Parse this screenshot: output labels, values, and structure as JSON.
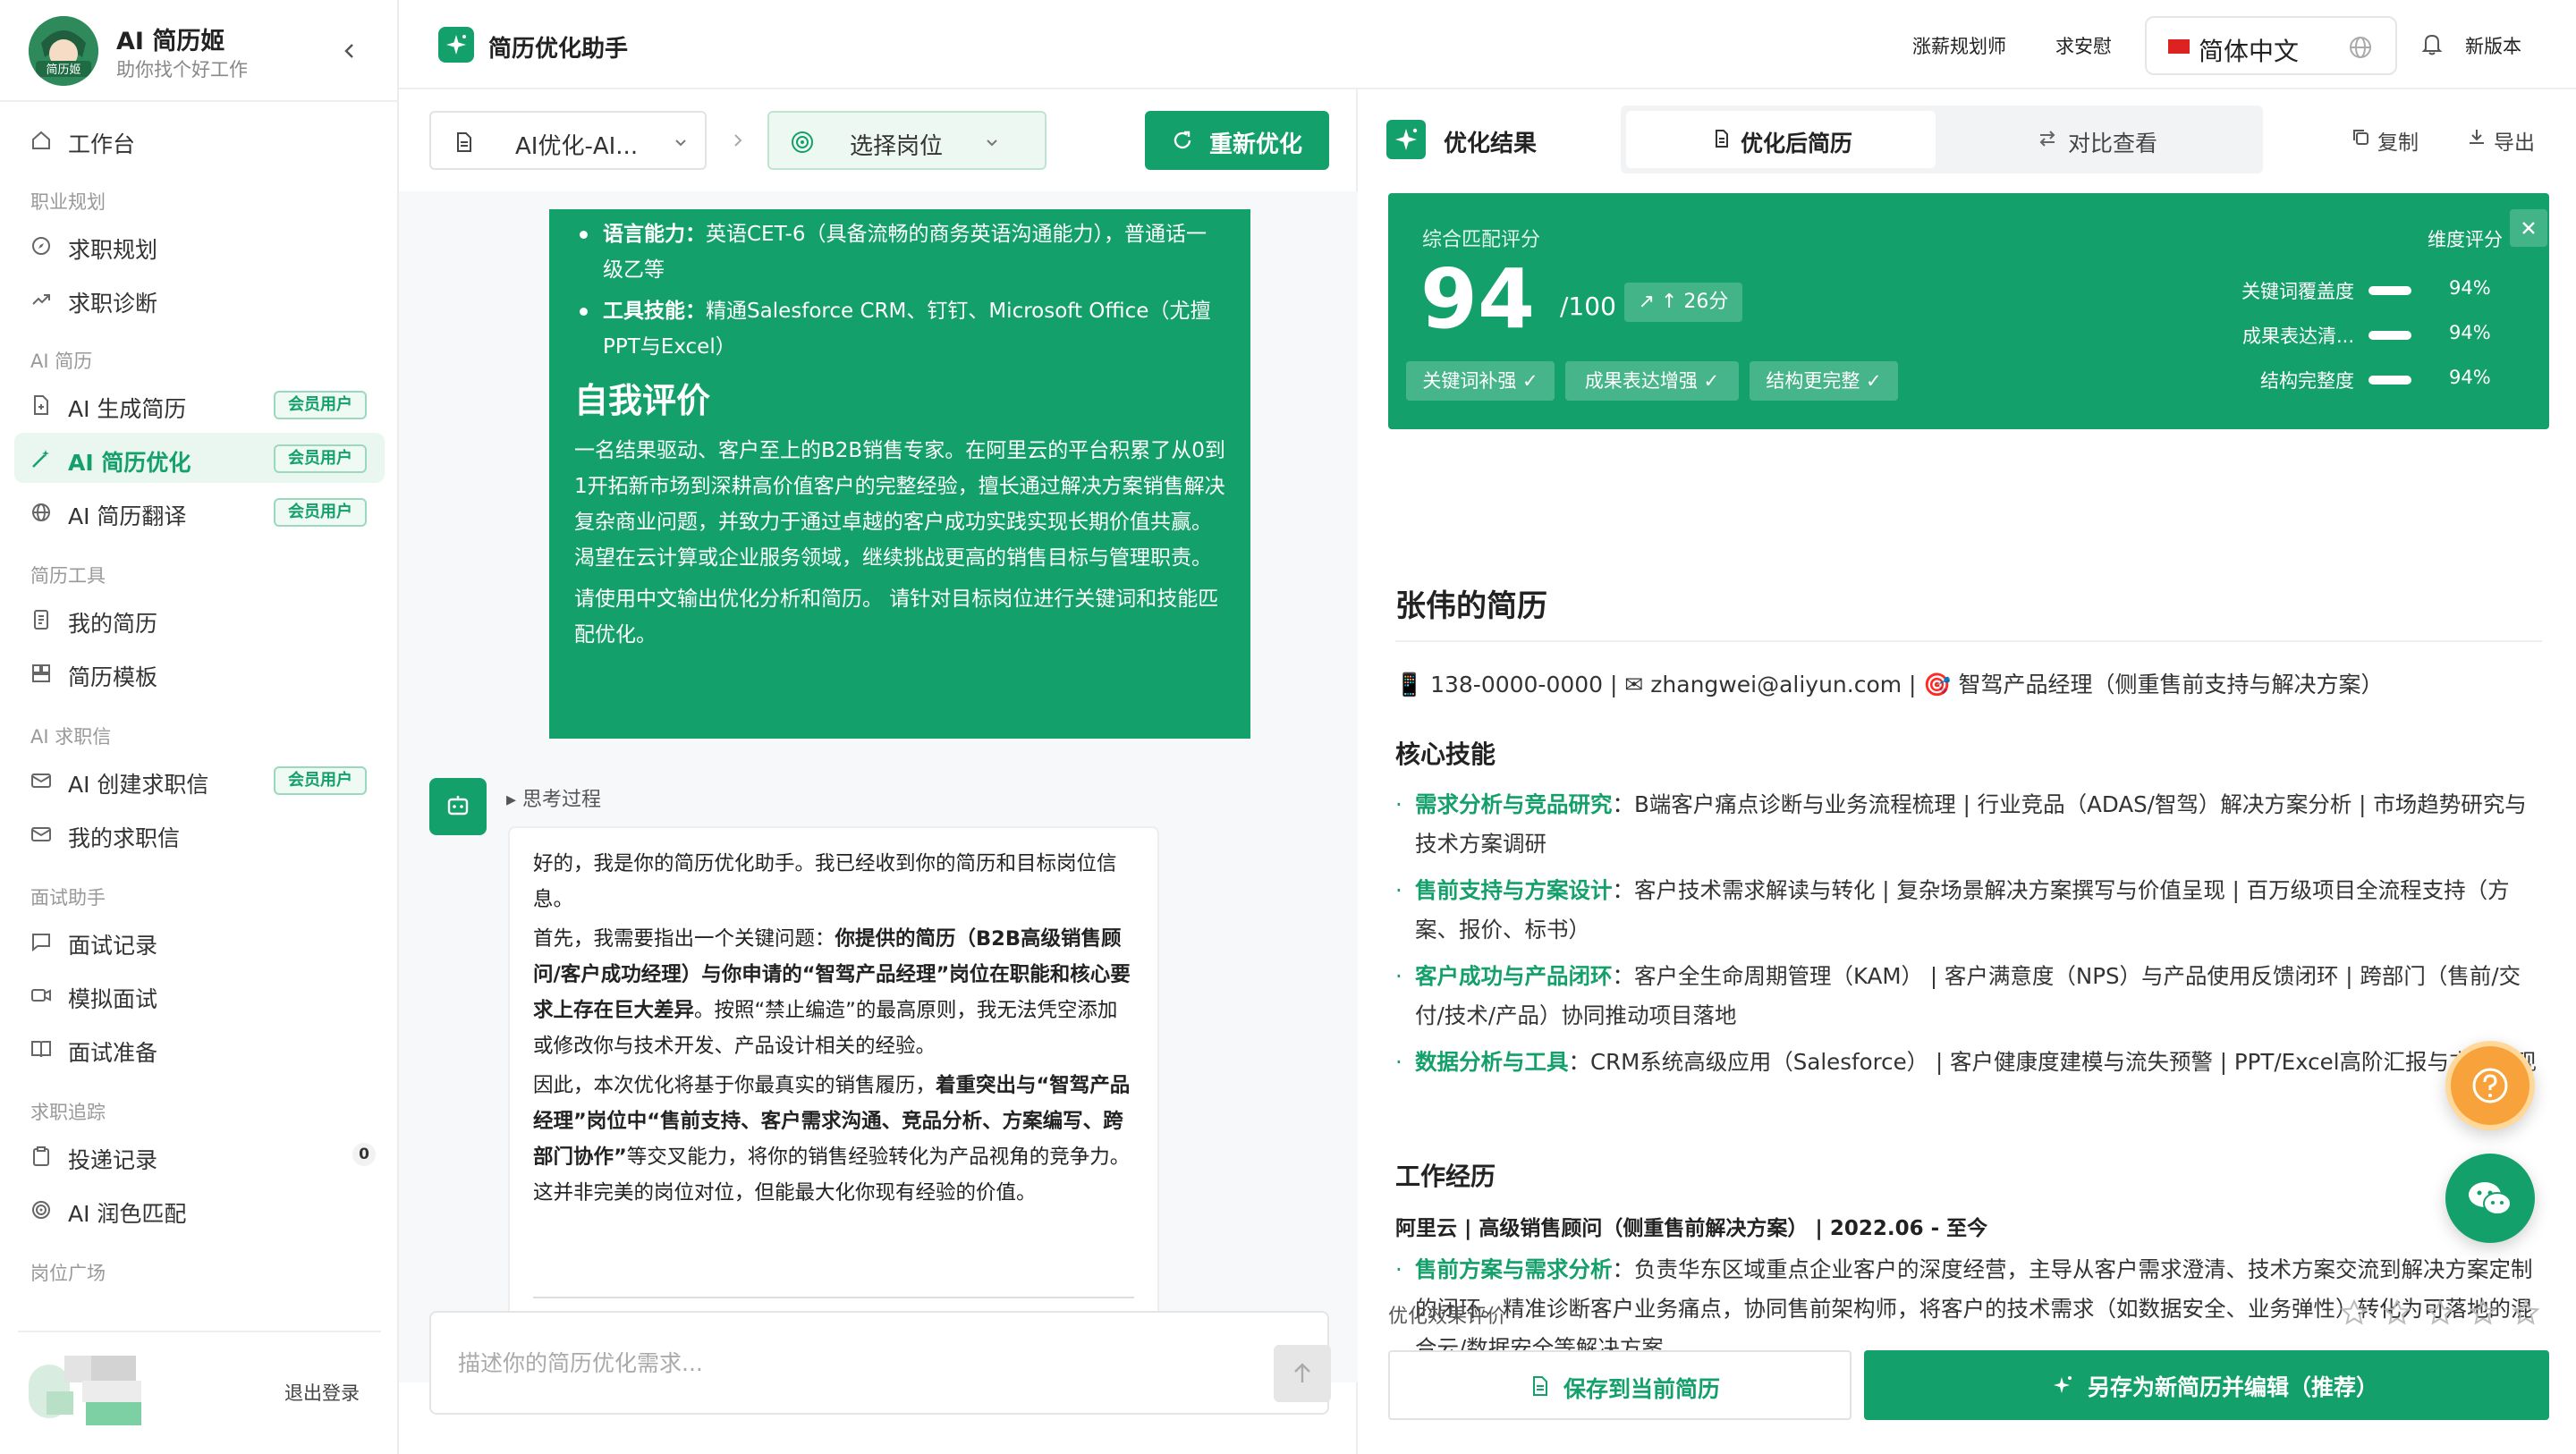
{
  "brand": {
    "title": "AI 简历姬",
    "subtitle": "助你找个好工作",
    "logo_text": "简历姬"
  },
  "sidebar": {
    "workbench": "工作台",
    "groups": [
      {
        "label": "职业规划",
        "items": [
          {
            "label": "求职规划"
          },
          {
            "label": "求职诊断"
          }
        ]
      },
      {
        "label": "AI 简历",
        "items": [
          {
            "label": "AI 生成简历",
            "badge": "会员用户"
          },
          {
            "label": "AI 简历优化",
            "badge": "会员用户"
          },
          {
            "label": "AI 简历翻译",
            "badge": "会员用户"
          }
        ]
      },
      {
        "label": "简历工具",
        "items": [
          {
            "label": "我的简历"
          },
          {
            "label": "简历模板"
          }
        ]
      },
      {
        "label": "AI 求职信",
        "items": [
          {
            "label": "AI 创建求职信",
            "badge": "会员用户"
          },
          {
            "label": "我的求职信"
          }
        ]
      },
      {
        "label": "面试助手",
        "items": [
          {
            "label": "面试记录"
          },
          {
            "label": "模拟面试"
          },
          {
            "label": "面试准备"
          }
        ]
      },
      {
        "label": "求职追踪",
        "items": [
          {
            "label": "投递记录",
            "count": "0"
          },
          {
            "label": "AI 润色匹配"
          }
        ]
      },
      {
        "label": "岗位广场",
        "items": []
      }
    ],
    "logout": "退出登录"
  },
  "header": {
    "title": "简历优化助手",
    "links": [
      "涨薪规划师",
      "求安慰"
    ],
    "language": "简体中文",
    "new_version": "新版本"
  },
  "chat": {
    "resume_select": "AI优化-AI...",
    "position_select": "选择岗位",
    "reoptimize": "重新优化",
    "user_message": {
      "bullets": [
        {
          "key": "语言能力：",
          "text": "英语CET-6（具备流畅的商务英语沟通能力），普通话一级乙等"
        },
        {
          "key": "工具技能：",
          "text": "精通Salesforce CRM、钉钉、Microsoft Office（尤擅PPT与Excel）"
        }
      ],
      "heading": "自我评价",
      "paragraph": "一名结果驱动、客户至上的B2B销售专家。在阿里云的平台积累了从0到1开拓新市场到深耕高价值客户的完整经验，擅长通过解决方案销售解决复杂商业问题，并致力于通过卓越的客户成功实践实现长期价值共赢。渴望在云计算或企业服务领域，继续挑战更高的销售目标与管理职责。",
      "instruction": "请使用中文输出优化分析和简历。 请针对目标岗位进行关键词和技能匹配优化。"
    },
    "thinking": "思考过程",
    "bot_message": {
      "p1": "好的，我是你的简历优化助手。我已经收到你的简历和目标岗位信息。",
      "p2_a": "首先，我需要指出一个关键问题：",
      "p2_b": "你提供的简历（B2B高级销售顾问/客户成功经理）与你申请的“智驾产品经理”岗位在职能和核心要求上存在巨大差异",
      "p2_c": "。按照“禁止编造”的最高原则，我无法凭空添加或修改你与技术开发、产品设计相关的经验。",
      "p3_a": "因此，本次优化将基于你最真实的销售履历，",
      "p3_b": "着重突出与“智驾产品经理”岗位中“售前支持、客户需求沟通、竞品分析、方案编写、跨部门协作”",
      "p3_c": "等交叉能力，将你的销售经验转化为产品视角的竞争力。这并非完美的岗位对位，但能最大化你现有经验的价值。"
    },
    "input_placeholder": "描述你的简历优化需求..."
  },
  "result": {
    "title": "优化结果",
    "tabs": [
      "优化后简历",
      "对比查看"
    ],
    "copy": "复制",
    "export": "导出",
    "score": {
      "label": "综合匹配评分",
      "value": "94",
      "denominator": "/100",
      "delta": "↑ 26分",
      "chips": [
        "关键词补强 ✓",
        "成果表达增强 ✓",
        "结构更完整 ✓"
      ],
      "dims_title": "维度评分",
      "dims": [
        {
          "name": "关键词覆盖度",
          "pct": "94%"
        },
        {
          "name": "成果表达清...",
          "pct": "94%"
        },
        {
          "name": "结构完整度",
          "pct": "94%"
        }
      ]
    },
    "resume": {
      "name": "张伟的简历",
      "contact": "📱 138-0000-0000 | ✉ zhangwei@aliyun.com | 🎯 智驾产品经理（侧重售前支持与解决方案）",
      "skills_h": "核心技能",
      "skills": [
        {
          "key": "需求分析与竞品研究",
          "text": "：B端客户痛点诊断与业务流程梳理 | 行业竞品（ADAS/智驾）解决方案分析 | 市场趋势研究与技术方案调研"
        },
        {
          "key": "售前支持与方案设计",
          "text": "：客户技术需求解读与转化 | 复杂场景解决方案撰写与价值呈现 | 百万级项目全流程支持（方案、报价、标书）"
        },
        {
          "key": "客户成功与产品闭环",
          "text": "：客户全生命周期管理（KAM） | 客户满意度（NPS）与产品使用反馈闭环 | 跨部门（售前/交付/技术/产品）协同推动项目落地"
        },
        {
          "key": "数据分析与工具",
          "text": "：CRM系统高级应用（Salesforce） | 客户健康度建模与流失预警 | PPT/Excel高阶汇报与方案呈现"
        }
      ],
      "exp_h": "工作经历",
      "job": "阿里云 | 高级销售顾问（侧重售前解决方案） | 2022.06 - 至今",
      "job_items": [
        {
          "key": "售前方案与需求分析",
          "text": "：负责华东区域重点企业客户的深度经营，主导从客户需求澄清、技术方案交流到解决方案定制的闭环。精准诊断客户业务痛点，协同售前架构师，将客户的技术需求（如数据安全、业务弹性）转化为可落地的混合云/数据安全等解决方案。"
        }
      ]
    },
    "rating_label": "优化效果评价",
    "save_current": "保存到当前简历",
    "save_new": "另存为新简历并编辑（推荐）"
  },
  "colors": {
    "accent": "#14a06b",
    "fab_help": "#f7a23a"
  }
}
